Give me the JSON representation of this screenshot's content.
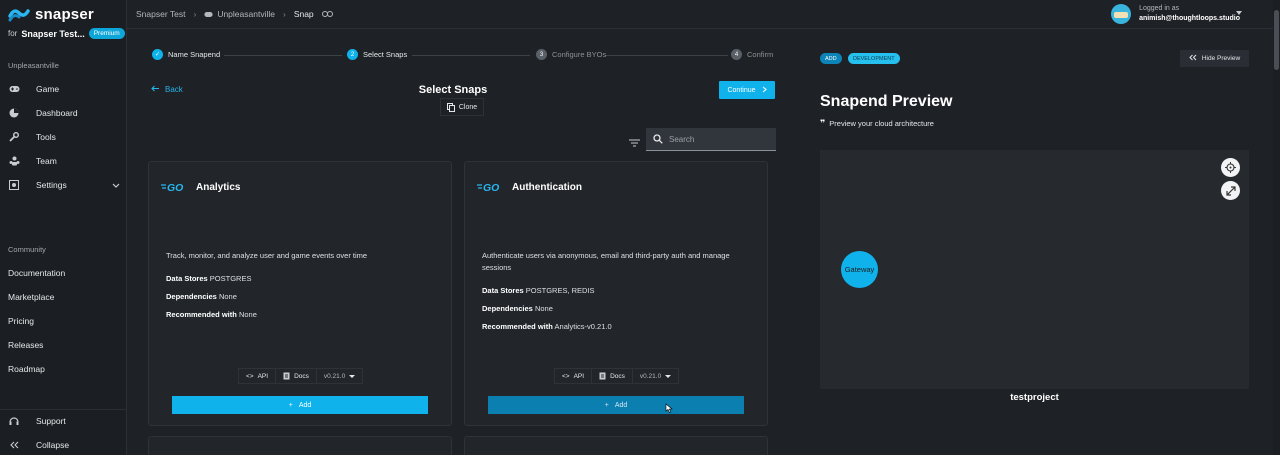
{
  "brand": {
    "name": "snapser",
    "for_label": "for",
    "org_name": "Snapser Test...",
    "plan_badge": "Premium"
  },
  "sidebar": {
    "project_label": "Unpleasantville",
    "items": [
      {
        "label": "Game",
        "icon": "gamepad-icon"
      },
      {
        "label": "Dashboard",
        "icon": "pie-chart-icon"
      },
      {
        "label": "Tools",
        "icon": "wrench-icon"
      },
      {
        "label": "Team",
        "icon": "team-icon"
      },
      {
        "label": "Settings",
        "icon": "settings-box-icon"
      }
    ],
    "community_label": "Community",
    "links": [
      "Documentation",
      "Marketplace",
      "Pricing",
      "Releases",
      "Roadmap"
    ],
    "support": "Support",
    "collapse": "Collapse"
  },
  "topbar": {
    "breadcrumb": [
      "Snapser Test",
      "Unpleasantville",
      "Snap"
    ],
    "user_logged_label": "Logged in as",
    "user_email": "animish@thoughtloops.studio"
  },
  "stepper": {
    "steps": [
      {
        "label": "Name Snapend",
        "state": "done",
        "num": "1"
      },
      {
        "label": "Select Snaps",
        "state": "active",
        "num": "2"
      },
      {
        "label": "Configure BYOs",
        "state": "pending",
        "num": "3"
      },
      {
        "label": "Confirm",
        "state": "pending",
        "num": "4"
      }
    ]
  },
  "header": {
    "back_label": "Back",
    "title": "Select Snaps",
    "clone_label": "Clone",
    "continue_label": "Continue",
    "search_placeholder": "Search"
  },
  "cards": [
    {
      "title": "Analytics",
      "description": "Track, monitor, and analyze user and game events over time",
      "data_stores_label": "Data Stores",
      "data_stores": "POSTGRES",
      "dependencies_label": "Dependencies",
      "dependencies": "None",
      "recommended_label": "Recommended with",
      "recommended": "None",
      "api_label": "API",
      "docs_label": "Docs",
      "version": "v0.21.0",
      "add_label": "Add"
    },
    {
      "title": "Authentication",
      "description": "Authenticate users via anonymous, email and third-party auth and manage sessions",
      "data_stores_label": "Data Stores",
      "data_stores": "POSTGRES, REDIS",
      "dependencies_label": "Dependencies",
      "dependencies": "None",
      "recommended_label": "Recommended with",
      "recommended": "Analytics-v0.21.0",
      "api_label": "API",
      "docs_label": "Docs",
      "version": "v0.21.0",
      "add_label": "Add"
    }
  ],
  "preview": {
    "tag_add": "ADD",
    "tag_env": "DEVELOPMENT",
    "hide_label": "Hide Preview",
    "title": "Snapend Preview",
    "subtitle": "Preview your cloud architecture",
    "node_label": "Gateway",
    "project_name": "testproject"
  },
  "colors": {
    "accent": "#0fb2ea",
    "add_hover": "#0b7fb0",
    "background": "#1e2125",
    "card": "#22262b"
  }
}
